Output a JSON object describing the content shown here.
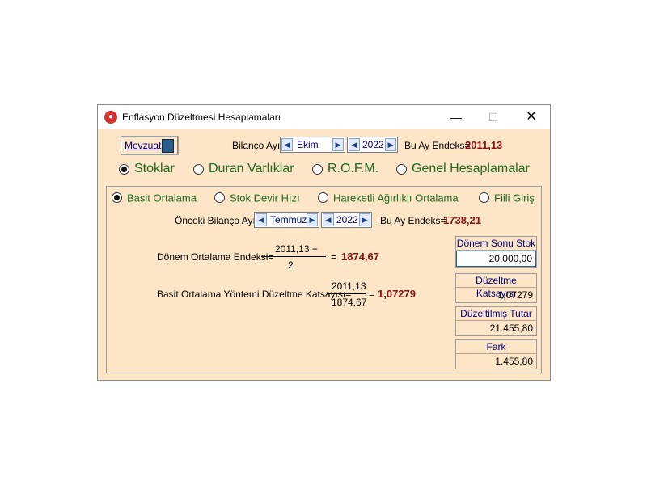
{
  "window": {
    "title": "Enflasyon Düzeltmesi Hesaplamaları",
    "min": "—",
    "max": "☐",
    "close": "✕"
  },
  "toolbar": {
    "mevzuat_label": "Mevzuat",
    "bilanco_label": "Bilanço Ayı",
    "month": "Ekim",
    "year": "2022",
    "endeks_label": "Bu Ay Endeks=",
    "endeks_value": "2011,13"
  },
  "main_tabs": [
    {
      "label": "Stoklar",
      "selected": true
    },
    {
      "label": "Duran Varlıklar",
      "selected": false
    },
    {
      "label": "R.O.F.M.",
      "selected": false
    },
    {
      "label": "Genel Hesaplamalar",
      "selected": false
    }
  ],
  "sub_tabs": [
    {
      "label": "Basit Ortalama",
      "selected": true
    },
    {
      "label": "Stok Devir Hızı",
      "selected": false
    },
    {
      "label": "Hareketli Ağırlıklı Ortalama",
      "selected": false
    },
    {
      "label": "Fiili Giriş",
      "selected": false
    }
  ],
  "previous": {
    "label": "Önceki Bilanço Ayı",
    "month": "Temmuz",
    "year": "2022",
    "endeks_label": "Bu Ay Endeks=",
    "endeks_value": "1738,21"
  },
  "formula1": {
    "label": "Dönem Ortalama Endeksi=",
    "numerator": "2011,13 +",
    "denominator": "2",
    "equals": "=",
    "result": "1874,67"
  },
  "formula2": {
    "label": "Basit Ortalama Yöntemi Düzeltme Katsayısı=",
    "numerator": "2011,13",
    "denominator": "1874,67",
    "equals": "=",
    "result": "1,07279"
  },
  "boxes": {
    "donem_sonu_stok": {
      "header": "Dönem Sonu Stok",
      "value": "20.000,00"
    },
    "duzeltme_katsayisi": {
      "header": "Düzeltme Katsayısı",
      "value": "1,07279"
    },
    "duzeltilmis_tutar": {
      "header": "Düzeltilmiş Tutar",
      "value": "21.455,80"
    },
    "fark": {
      "header": "Fark",
      "value": "1.455,80"
    }
  }
}
